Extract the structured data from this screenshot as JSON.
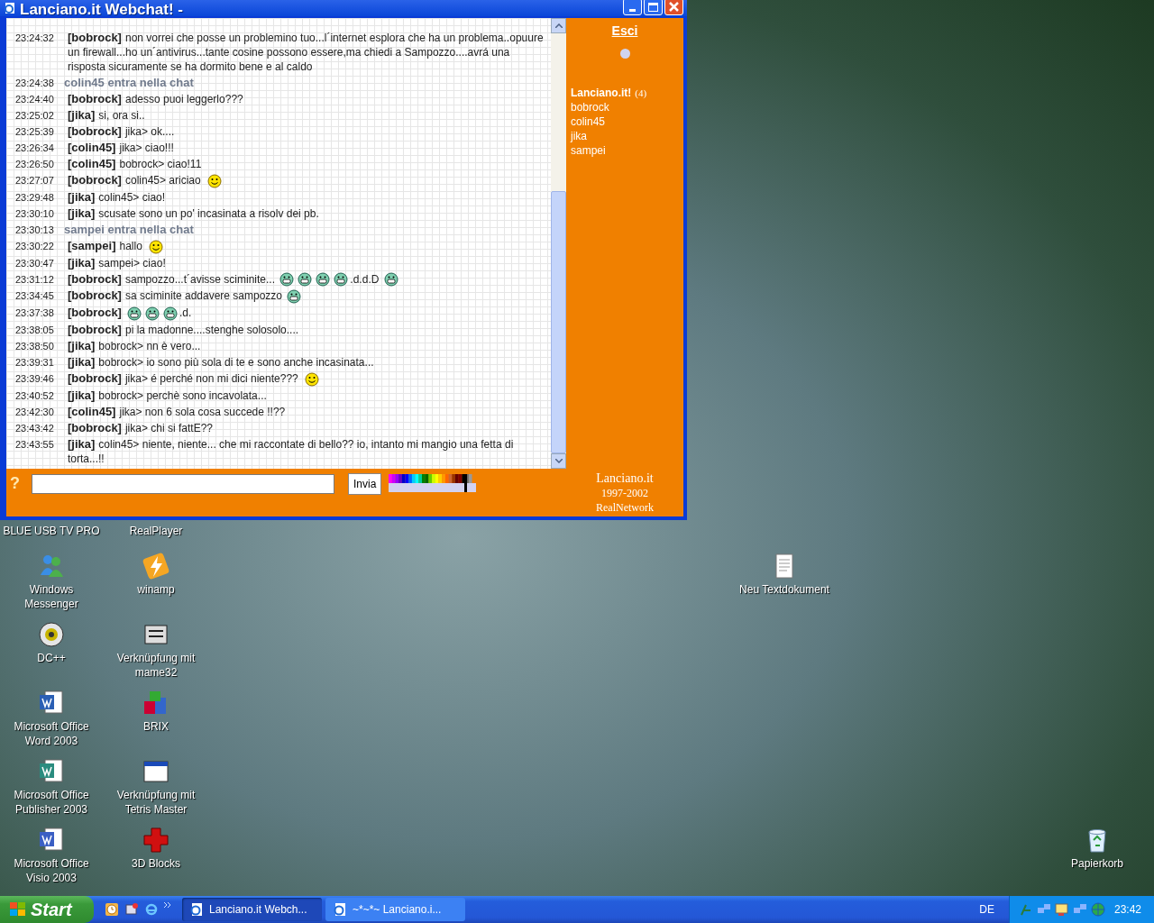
{
  "window": {
    "title": "Lanciano.it Webchat! -"
  },
  "chat": {
    "messages": [
      {
        "kind": "message",
        "time": "23:24:32",
        "user": "[bobrock]",
        "parts": [
          {
            "kind": "text",
            "text": "non vorrei che posse un problemino tuo...l´internet esplora che ha un problema..opuure un firewall...ho un´antivirus...tante cosine possono essere,ma chiedi a Sampozzo....avrá una risposta sicuramente se ha dormito bene e al caldo"
          }
        ]
      },
      {
        "kind": "join",
        "time": "23:24:38",
        "text": "colin45 entra nella chat"
      },
      {
        "kind": "message",
        "time": "23:24:40",
        "user": "[bobrock]",
        "parts": [
          {
            "kind": "text",
            "text": "adesso puoi leggerlo???"
          }
        ]
      },
      {
        "kind": "message",
        "time": "23:25:02",
        "user": "[jika]",
        "parts": [
          {
            "kind": "text",
            "text": "si, ora si.."
          }
        ]
      },
      {
        "kind": "message",
        "time": "23:25:39",
        "user": "[bobrock]",
        "parts": [
          {
            "kind": "text",
            "text": "jika> ok...."
          }
        ]
      },
      {
        "kind": "message",
        "time": "23:26:34",
        "user": "[colin45]",
        "parts": [
          {
            "kind": "text",
            "text": "jika> ciao!!!"
          }
        ]
      },
      {
        "kind": "message",
        "time": "23:26:50",
        "user": "[colin45]",
        "parts": [
          {
            "kind": "text",
            "text": "bobrock> ciao!11"
          }
        ]
      },
      {
        "kind": "message",
        "time": "23:27:07",
        "user": "[bobrock]",
        "parts": [
          {
            "kind": "text",
            "text": "colin45> ariciao"
          },
          {
            "kind": "smile"
          }
        ]
      },
      {
        "kind": "message",
        "time": "23:29:48",
        "user": "[jika]",
        "parts": [
          {
            "kind": "text",
            "text": "colin45> ciao!"
          }
        ]
      },
      {
        "kind": "message",
        "time": "23:30:10",
        "user": "[jika]",
        "parts": [
          {
            "kind": "text",
            "text": "scusate sono un po' incasinata a risolv dei pb."
          }
        ]
      },
      {
        "kind": "join",
        "time": "23:30:13",
        "text": "sampei entra nella chat"
      },
      {
        "kind": "message",
        "time": "23:30:22",
        "user": "[sampei]",
        "parts": [
          {
            "kind": "text",
            "text": "hallo"
          },
          {
            "kind": "smile"
          }
        ]
      },
      {
        "kind": "message",
        "time": "23:30:47",
        "user": "[jika]",
        "parts": [
          {
            "kind": "text",
            "text": "sampei> ciao!"
          }
        ]
      },
      {
        "kind": "message",
        "time": "23:31:12",
        "user": "[bobrock]",
        "parts": [
          {
            "kind": "text",
            "text": "sampozzo...t´avisse sciminite..."
          },
          {
            "kind": "grin"
          },
          {
            "kind": "grin"
          },
          {
            "kind": "grin"
          },
          {
            "kind": "grin"
          },
          {
            "kind": "text",
            "text": ".d.d.D"
          },
          {
            "kind": "grin"
          }
        ]
      },
      {
        "kind": "message",
        "time": "23:34:45",
        "user": "[bobrock]",
        "parts": [
          {
            "kind": "text",
            "text": "sa sciminite addavere sampozzo"
          },
          {
            "kind": "grin"
          }
        ]
      },
      {
        "kind": "message",
        "time": "23:37:38",
        "user": "[bobrock]",
        "parts": [
          {
            "kind": "grin"
          },
          {
            "kind": "grin"
          },
          {
            "kind": "grin"
          },
          {
            "kind": "text",
            "text": ".d."
          }
        ]
      },
      {
        "kind": "message",
        "time": "23:38:05",
        "user": "[bobrock]",
        "parts": [
          {
            "kind": "text",
            "text": "pi la madonne....stenghe solosolo...."
          }
        ]
      },
      {
        "kind": "message",
        "time": "23:38:50",
        "user": "[jika]",
        "parts": [
          {
            "kind": "text",
            "text": "bobrock> nn è vero..."
          }
        ]
      },
      {
        "kind": "message",
        "time": "23:39:31",
        "user": "[jika]",
        "parts": [
          {
            "kind": "text",
            "text": "bobrock> io sono più sola di te e sono anche incasinata..."
          }
        ]
      },
      {
        "kind": "message",
        "time": "23:39:46",
        "user": "[bobrock]",
        "parts": [
          {
            "kind": "text",
            "text": "jika> é perché non mi dici niente???"
          },
          {
            "kind": "smile"
          }
        ]
      },
      {
        "kind": "message",
        "time": "23:40:52",
        "user": "[jika]",
        "parts": [
          {
            "kind": "text",
            "text": "bobrock> perchè sono incavolata..."
          }
        ]
      },
      {
        "kind": "message",
        "time": "23:42:30",
        "user": "[colin45]",
        "parts": [
          {
            "kind": "text",
            "text": "jika> non 6 sola cosa succede !!??"
          }
        ]
      },
      {
        "kind": "message",
        "time": "23:43:42",
        "user": "[bobrock]",
        "parts": [
          {
            "kind": "text",
            "text": "jika> chi si fattE??"
          }
        ]
      },
      {
        "kind": "message",
        "time": "23:43:55",
        "user": "[jika]",
        "parts": [
          {
            "kind": "text",
            "text": "colin45> niente, niente... che mi raccontate di bello?? io, intanto mi mangio una fetta di torta...!!"
          }
        ]
      }
    ],
    "help": "?",
    "send_button": "Invia"
  },
  "side_panel": {
    "exit_link": "Esci",
    "room": {
      "name": "Lanciano.it!",
      "count": "(4)"
    },
    "users": [
      "bobrock",
      "colin45",
      "jika",
      "sampei"
    ],
    "footer": [
      "Lanciano.it",
      "1997-2002",
      "RealNetwork"
    ]
  },
  "desktop_icons": [
    {
      "kind": "hidden",
      "label": "BLUE USB TV PRO"
    },
    {
      "kind": "hidden",
      "label": "RealPlayer"
    },
    {
      "kind": "messenger",
      "label": "Windows Messenger"
    },
    {
      "kind": "winamp",
      "label": "winamp"
    },
    {
      "kind": "textdoc",
      "label": "Neu Textdokument"
    },
    {
      "kind": "disc",
      "label": "DC++"
    },
    {
      "kind": "mame",
      "label": "Verknüpfung mit mame32"
    },
    {
      "kind": "word",
      "label": "Microsoft Office Word 2003"
    },
    {
      "kind": "blocks",
      "label": "BRIX"
    },
    {
      "kind": "publisher",
      "label": "Microsoft Office Publisher 2003"
    },
    {
      "kind": "window",
      "label": "Verknüpfung mit Tetris Master"
    },
    {
      "kind": "visio",
      "label": "Microsoft Office Visio 2003"
    },
    {
      "kind": "cross",
      "label": "3D Blocks"
    },
    {
      "kind": "recycle",
      "label": "Papierkorb"
    }
  ],
  "taskbar": {
    "start": "Start",
    "tasks": [
      {
        "label": "Lanciano.it Webch...",
        "selected": true
      },
      {
        "label": "~*~*~ Lanciano.i...",
        "selected": false
      }
    ],
    "language": "DE",
    "clock": "23:42"
  }
}
